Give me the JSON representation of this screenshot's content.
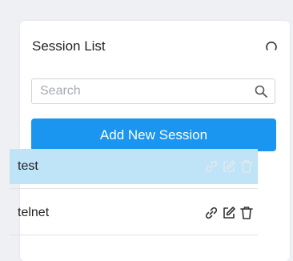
{
  "session_panel": {
    "title": "Session List",
    "refresh_icon": "refresh-icon",
    "search": {
      "placeholder": "Search",
      "value": "",
      "icon": "search-icon"
    },
    "add_button_label": "Add New Session",
    "sessions": [
      {
        "name": "test",
        "selected": true,
        "actions": [
          "link-icon",
          "edit-icon",
          "delete-icon"
        ]
      },
      {
        "name": "telnet",
        "selected": false,
        "actions": [
          "link-icon",
          "edit-icon",
          "delete-icon"
        ]
      }
    ]
  },
  "colors": {
    "accent": "#1a95f0",
    "selected_row": "#bfe3f7",
    "icon_active": "#333333",
    "icon_faded": "#e3e8ec"
  }
}
